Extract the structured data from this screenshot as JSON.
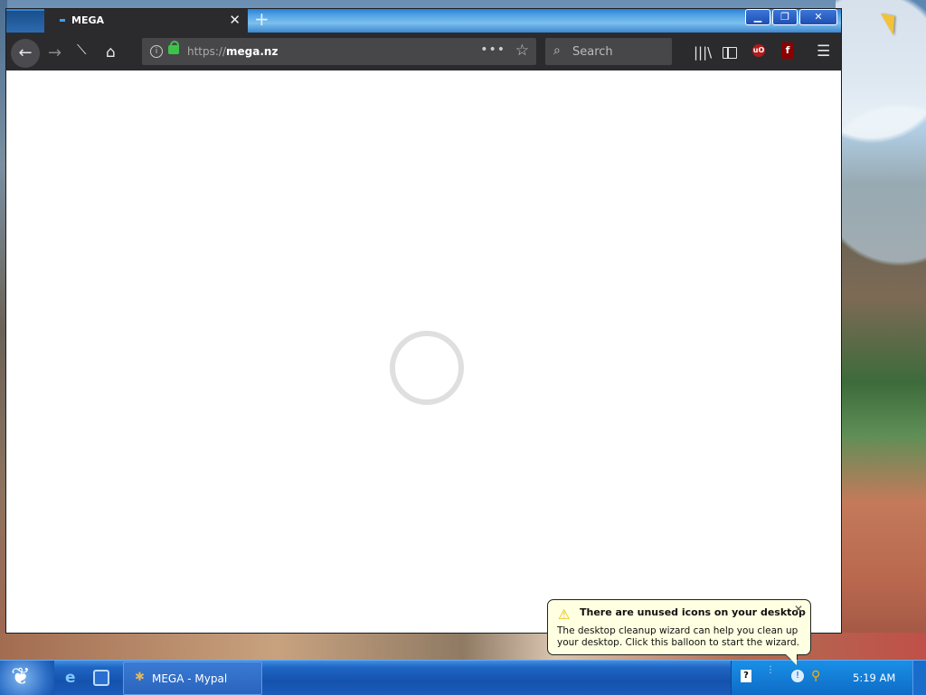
{
  "browser": {
    "tab": {
      "title": "MEGA",
      "close": "✕"
    },
    "newtab": "+",
    "window_buttons": {
      "minimize": "▁",
      "maximize": "❐",
      "close": "✕"
    },
    "url": {
      "scheme": "https://",
      "host": "mega.nz"
    },
    "search_placeholder": "Search",
    "url_more": "•••",
    "icons": [
      "back-icon",
      "forward-icon",
      "stop-icon",
      "home-icon",
      "info-icon",
      "lock-icon",
      "bookmark-star-icon",
      "search-icon",
      "library-icon",
      "sidebar-icon",
      "ublock-icon",
      "flash-icon",
      "menu-icon"
    ],
    "extensions": {
      "ublock": "uO",
      "flash": "f"
    },
    "page_state": "loading"
  },
  "balloon": {
    "title": "There are unused icons on your desktop",
    "body": "The desktop cleanup wizard can help you clean up your desktop. Click this balloon to start the wizard.",
    "close": "✕"
  },
  "taskbar": {
    "task_label": "MEGA - Mypal",
    "clock": "5:19 AM",
    "tray_help": "?"
  },
  "colors": {
    "taskbar_blue": "#1552ad",
    "tray_blue": "#0e6cc6",
    "browser_chrome": "#2b2b2e",
    "balloon_bg": "#ffffe1",
    "lock_green": "#3ec34a"
  }
}
